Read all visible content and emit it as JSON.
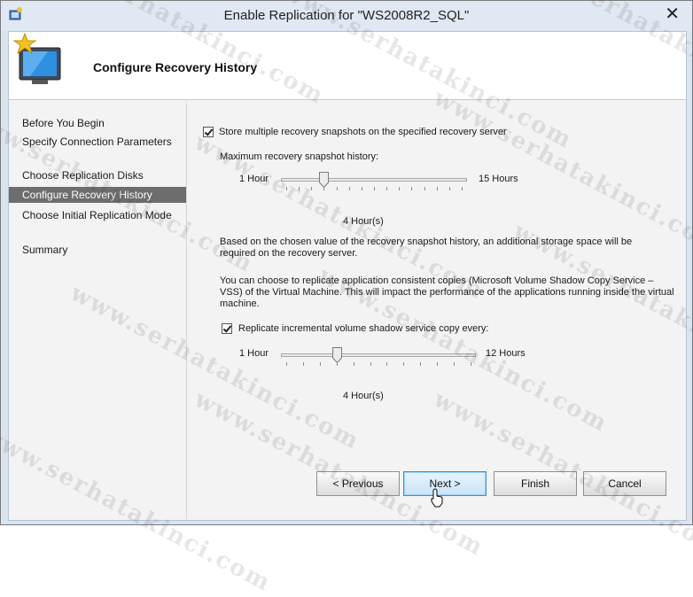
{
  "window": {
    "title": "Enable Replication for \"WS2008R2_SQL\""
  },
  "header": {
    "title": "Configure Recovery History"
  },
  "nav": {
    "items": [
      {
        "label": "Before You Begin"
      },
      {
        "label": "Specify Connection Parameters"
      },
      {
        "label": "Choose Replication Disks"
      },
      {
        "label": "Configure Recovery History",
        "active": true
      },
      {
        "label": "Choose Initial Replication Mode"
      },
      {
        "label": "Summary"
      }
    ]
  },
  "content": {
    "store_snapshots": {
      "label": "Store multiple recovery snapshots on the specified recovery server",
      "checked": true
    },
    "max_history_label": "Maximum recovery snapshot history:",
    "snapshot_slider": {
      "min_label": "1 Hour",
      "max_label": "15 Hours",
      "min": 1,
      "max": 15,
      "value": 4,
      "value_label": "4 Hour(s)"
    },
    "storage_note": "Based on the chosen value of the recovery snapshot history, an additional storage space will be required on the recovery server.",
    "vss_note": "You can choose to replicate application consistent copies (Microsoft Volume Shadow Copy Service – VSS) of the Virtual Machine. This will impact the performance of the applications running inside the virtual machine.",
    "vss_checkbox": {
      "label": "Replicate incremental volume shadow service copy every:",
      "checked": true
    },
    "vss_slider": {
      "min_label": "1 Hour",
      "max_label": "12 Hours",
      "min": 1,
      "max": 12,
      "value": 4,
      "value_label": "4 Hour(s)"
    }
  },
  "buttons": {
    "previous": "< Previous",
    "next": "Next >",
    "finish": "Finish",
    "cancel": "Cancel"
  },
  "watermark": "www.serhatakinci.com",
  "icons": {
    "app": "hyper-v-manager-icon",
    "wizard": "monitor-star-icon",
    "close": "close-icon"
  }
}
